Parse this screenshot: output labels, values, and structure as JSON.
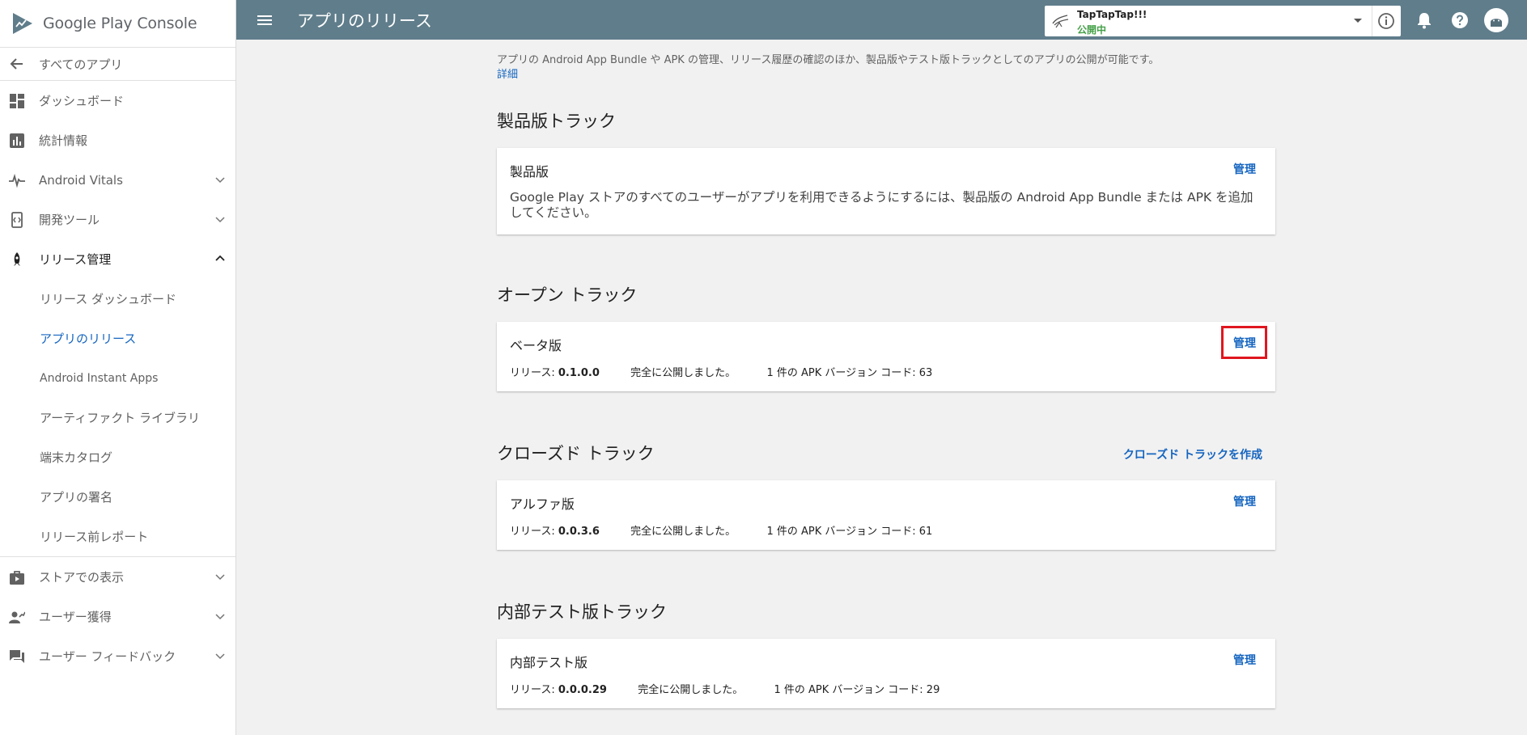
{
  "brand": {
    "logo_main": "Google Play",
    "logo_sub": "Console"
  },
  "sidebar": {
    "back_label": "すべてのアプリ",
    "items": [
      {
        "label": "ダッシュボード"
      },
      {
        "label": "統計情報"
      },
      {
        "label": "Android Vitals"
      },
      {
        "label": "開発ツール"
      },
      {
        "label": "リリース管理"
      }
    ],
    "release_sub": [
      {
        "label": "リリース ダッシュボード"
      },
      {
        "label": "アプリのリリース"
      },
      {
        "label": "Android Instant Apps"
      },
      {
        "label": "アーティファクト ライブラリ"
      },
      {
        "label": "端末カタログ"
      },
      {
        "label": "アプリの署名"
      },
      {
        "label": "リリース前レポート"
      }
    ],
    "bottom_items": [
      {
        "label": "ストアでの表示"
      },
      {
        "label": "ユーザー獲得"
      },
      {
        "label": "ユーザー フィードバック"
      }
    ]
  },
  "header": {
    "title": "アプリのリリース",
    "app_name": "TapTapTap!!!",
    "app_status": "公開中"
  },
  "main": {
    "intro": "アプリの Android App Bundle や APK の管理、リリース履歴の確認のほか、製品版やテスト版トラックとしてのアプリの公開が可能です。",
    "detail_link": "詳細",
    "manage_label": "管理",
    "release_prefix": "リリース: ",
    "production": {
      "section_title": "製品版トラック",
      "card_title": "製品版",
      "description": "Google Play ストアのすべてのユーザーがアプリを利用できるようにするには、製品版の Android App Bundle または APK を追加してください。"
    },
    "open": {
      "section_title": "オープン トラック",
      "card_title": "ベータ版",
      "version": "0.1.0.0",
      "status": "完全に公開しました。",
      "apk": "1 件の APK バージョン コード: 63"
    },
    "closed": {
      "section_title": "クローズド トラック",
      "create_label": "クローズド トラックを作成",
      "card_title": "アルファ版",
      "version": "0.0.3.6",
      "status": "完全に公開しました。",
      "apk": "1 件の APK バージョン コード: 61"
    },
    "internal": {
      "section_title": "内部テスト版トラック",
      "card_title": "内部テスト版",
      "version": "0.0.0.29",
      "status": "完全に公開しました。",
      "apk": "1 件の APK バージョン コード: 29"
    }
  },
  "colors": {
    "header_bg": "#607d8b",
    "link": "#1565c0",
    "status_green": "#43a047",
    "highlight": "#e0161f"
  }
}
